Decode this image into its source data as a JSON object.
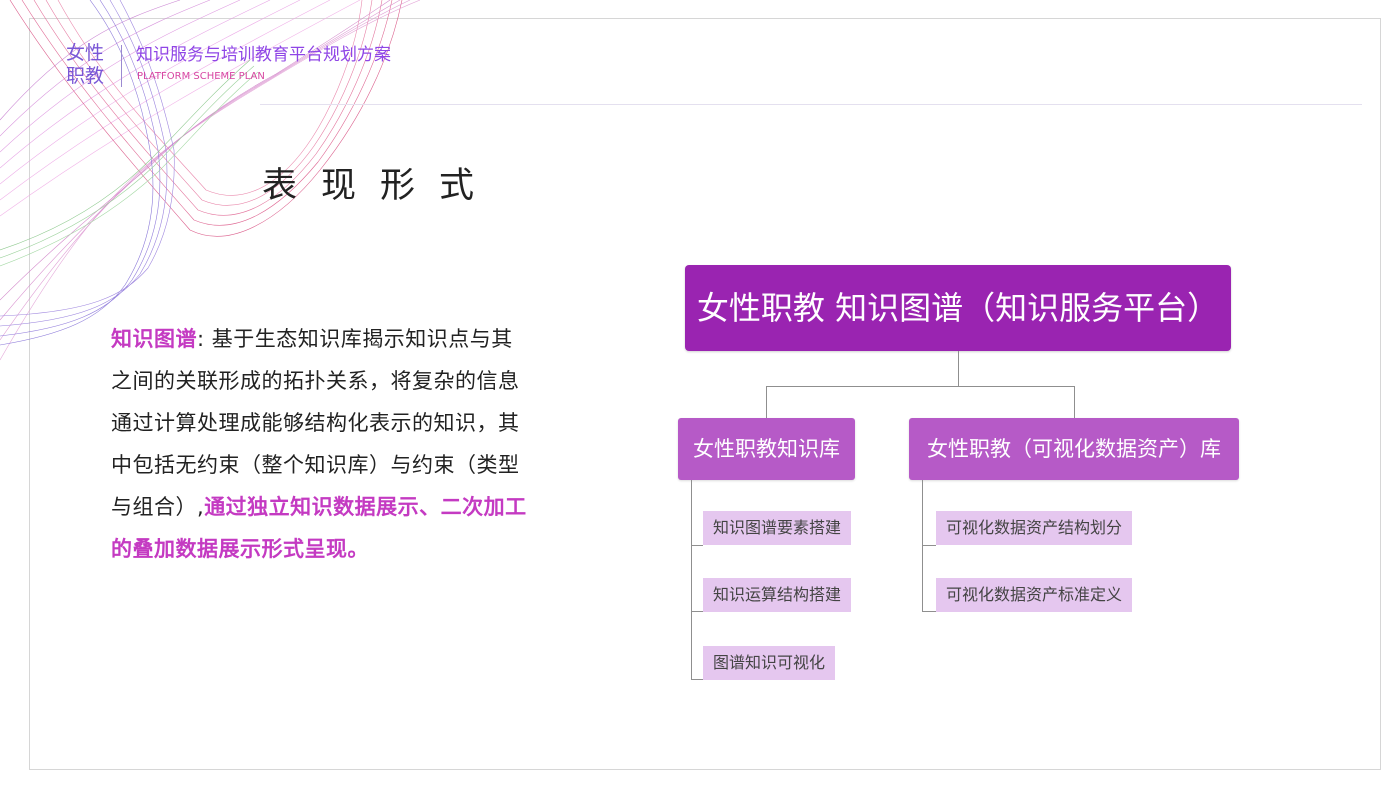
{
  "header": {
    "logo_line1": "女性",
    "logo_line2": "职教",
    "platform_title": "知识服务与培训教育平台规划方案",
    "platform_subtitle": "PLATFORM SCHEME PLAN"
  },
  "section": {
    "title": "表现形式"
  },
  "paragraph": {
    "term": "知识图谱",
    "body": ": 基于生态知识库揭示知识点与其之间的关联形成的拓扑关系，将复杂的信息通过计算处理成能够结构化表示的知识，其中包括无约束（整个知识库）与约束（类型与组合）,",
    "highlight": "通过独立知识数据展示、二次加工的叠加数据展示形式呈现",
    "end": "。"
  },
  "diagram": {
    "root": "女性职教 知识图谱（知识服务平台）",
    "left_branch": {
      "label": "女性职教知识库",
      "items": [
        "知识图谱要素搭建",
        "知识运算结构搭建",
        "图谱知识可视化"
      ]
    },
    "right_branch": {
      "label": "女性职教（可视化数据资产）库",
      "items": [
        "可视化数据资产结构划分",
        "可视化数据资产标准定义"
      ]
    }
  },
  "colors": {
    "accent_purple": "#9a24b1",
    "branch_purple": "#b65ac7",
    "leaf_lilac": "#e5c7ef",
    "highlight_pink": "#c43ac2",
    "logo_blue_purple": "#7a57d6",
    "subtitle_pink": "#d746a2"
  }
}
